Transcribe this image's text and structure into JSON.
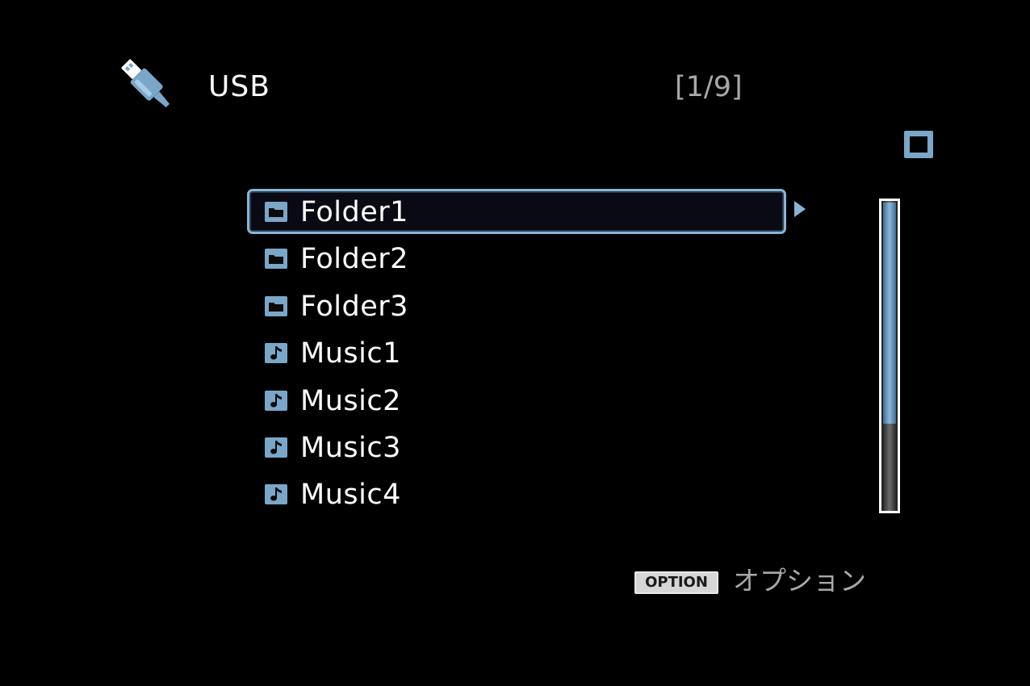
{
  "header": {
    "title": "USB",
    "page_indicator": "[1/9]",
    "source_icon": "usb-plug-icon"
  },
  "playback": {
    "status_icon": "stop-icon"
  },
  "list": {
    "selected_index": 0,
    "items": [
      {
        "label": "Folder1",
        "type": "folder",
        "icon": "folder-icon"
      },
      {
        "label": "Folder2",
        "type": "folder",
        "icon": "folder-icon"
      },
      {
        "label": "Folder3",
        "type": "folder",
        "icon": "folder-icon"
      },
      {
        "label": "Music1",
        "type": "music",
        "icon": "music-note-icon"
      },
      {
        "label": "Music2",
        "type": "music",
        "icon": "music-note-icon"
      },
      {
        "label": "Music3",
        "type": "music",
        "icon": "music-note-icon"
      },
      {
        "label": "Music4",
        "type": "music",
        "icon": "music-note-icon"
      }
    ]
  },
  "scrollbar": {
    "visible_fraction": 0.72,
    "position_fraction": 0.0
  },
  "footer": {
    "option_button": "OPTION",
    "option_label": "オプション"
  },
  "colors": {
    "accent": "#8ab4d6",
    "background": "#000000",
    "text": "#ffffff",
    "muted_text": "#a8a8a8"
  }
}
